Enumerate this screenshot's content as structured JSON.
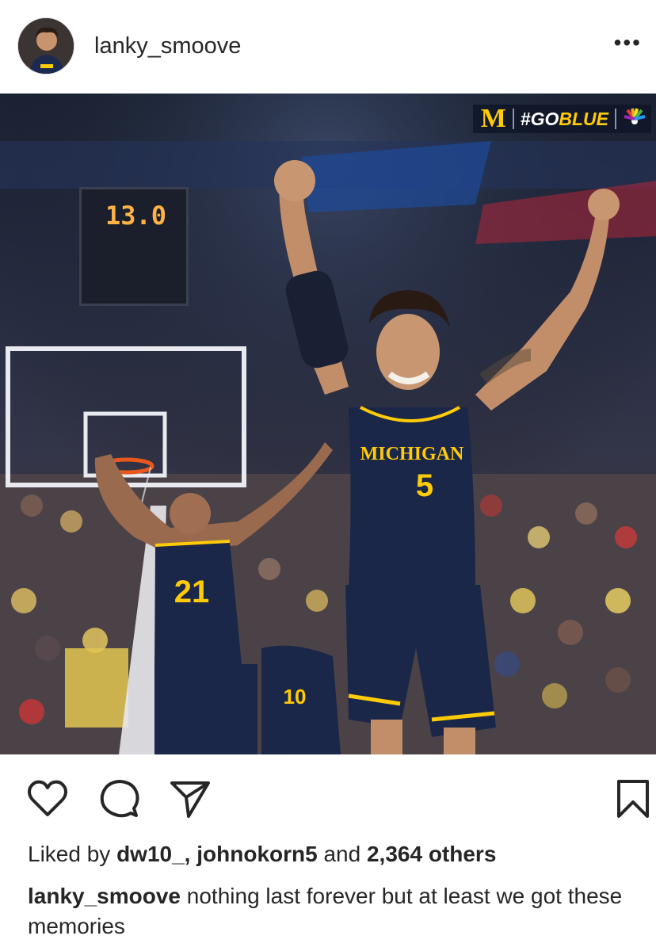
{
  "post": {
    "username": "lanky_smoove",
    "more_label": "•••",
    "photo": {
      "brand_letter": "M",
      "brand_hashtag_prefix": "#GO",
      "brand_hashtag_suffix": "BLUE",
      "shot_clock": "13.0",
      "jersey_main_text": "MICHIGAN",
      "jersey_main_number": "5",
      "jersey_left_number": "21",
      "jersey_back_number": "10"
    },
    "likes": {
      "prefix": "Liked by",
      "user1": "dw10_,",
      "user2": "johnokorn5",
      "and": "and",
      "count": "2,364 others"
    },
    "caption": {
      "username": "lanky_smoove",
      "text": "nothing last forever but at least we got these memories"
    }
  },
  "colors": {
    "navy": "#1b2748",
    "maize": "#ffcb05",
    "text": "#262626"
  },
  "icons": [
    "heart-icon",
    "comment-icon",
    "share-icon",
    "bookmark-icon",
    "more-icon"
  ]
}
